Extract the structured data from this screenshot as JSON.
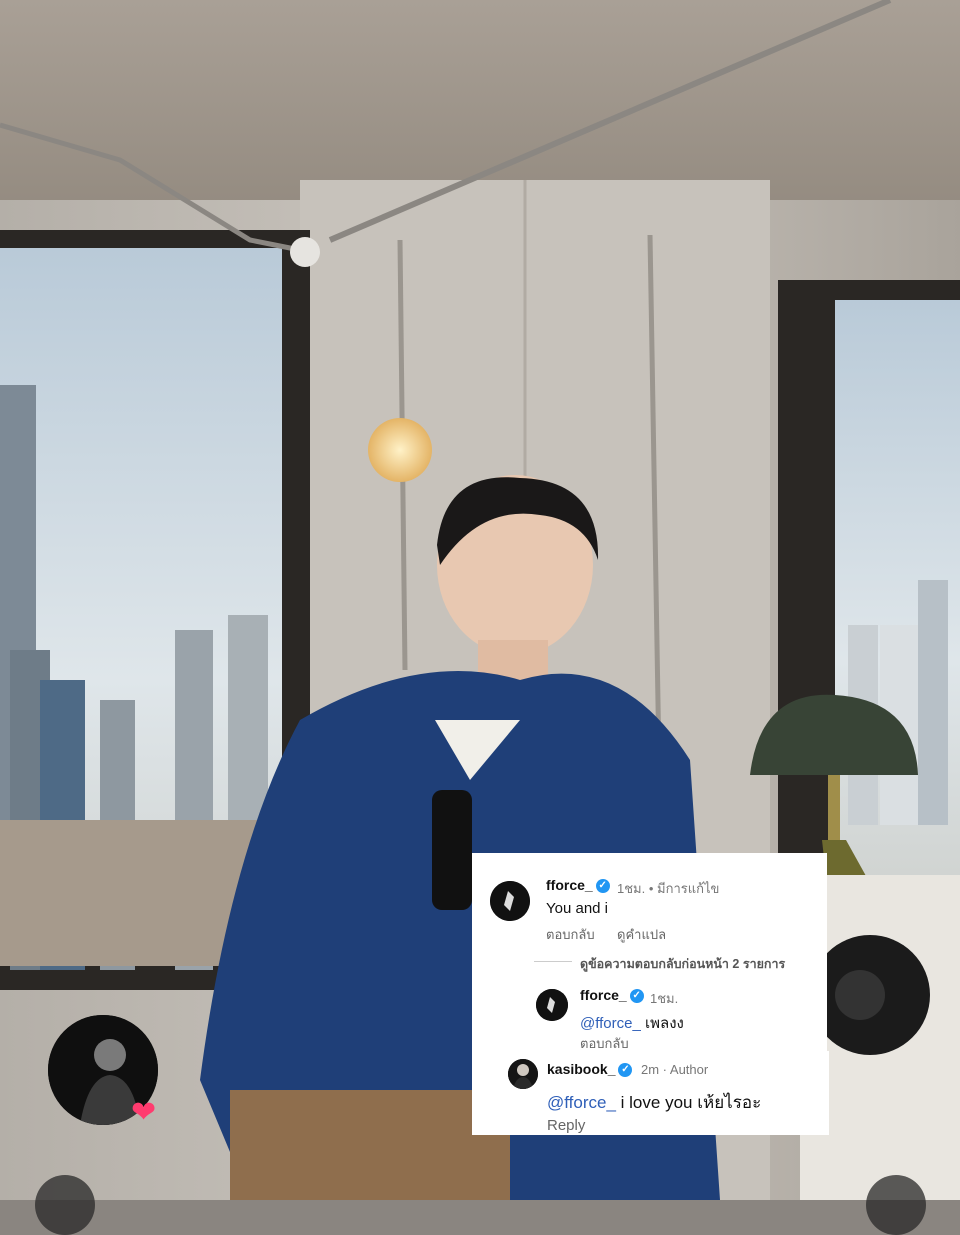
{
  "story": {
    "avatar_icon": "profile-avatar-icon",
    "heart_icon": "heart-icon",
    "heart_glyph": "❤"
  },
  "comment": {
    "username": "fforce_",
    "time": "1ชม.",
    "edited": "• มีการแก้ไข",
    "text": "You and i",
    "reply_label": "ตอบกลับ",
    "translate_label": "ดูคำแปล",
    "view_previous": "ดูข้อความตอบกลับก่อนหน้า 2 รายการ"
  },
  "nested_reply": {
    "username": "fforce_",
    "time": "1ชม.",
    "mention": "@fforce_",
    "text": "เพลงง",
    "reply_label": "ตอบกลับ"
  },
  "author_reply": {
    "username": "kasibook_",
    "meta": "2m · Author",
    "mention": "@fforce_",
    "text": "i love you เห้ยไรอะ",
    "reply_label": "Reply"
  },
  "colors": {
    "verified": "#2196f3",
    "mention": "#2f5fb8",
    "heart": "#ff3b6f",
    "jacket": "#1f3f78"
  }
}
